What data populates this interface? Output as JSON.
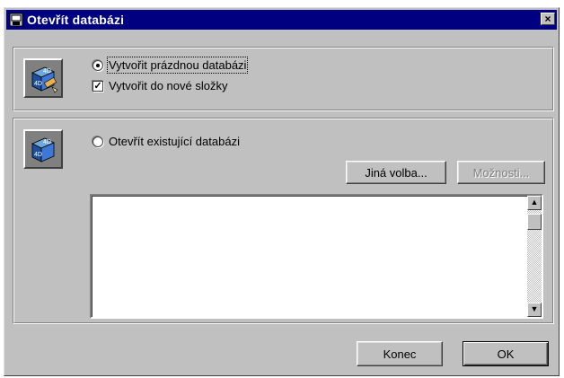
{
  "window": {
    "title": "Otevřít databázi",
    "close_label": "×"
  },
  "create_section": {
    "radio_label": "Vytvořit prázdnou databázi",
    "radio_selected": true,
    "checkbox_label": "Vytvořit do nové složky",
    "checkbox_checked": true,
    "check_mark": "✓"
  },
  "open_section": {
    "radio_label": "Otevřít existující databázi",
    "radio_selected": false,
    "other_button": "Jiná volba...",
    "options_button": "Možnosti...",
    "options_disabled": true,
    "list_items": []
  },
  "footer": {
    "end_button": "Konec",
    "ok_button": "OK"
  },
  "scroll": {
    "up": "▲",
    "down": "▼"
  },
  "colors": {
    "titlebar": "#000080",
    "face": "#c0c0c0"
  }
}
